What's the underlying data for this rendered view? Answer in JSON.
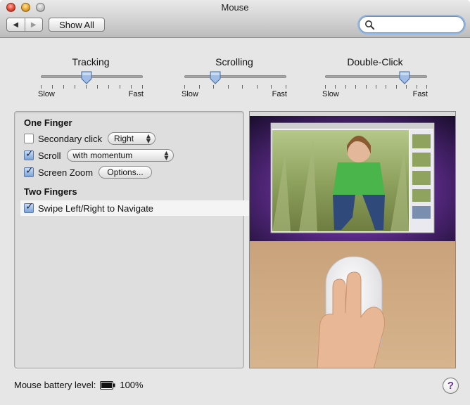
{
  "window": {
    "title": "Mouse"
  },
  "toolbar": {
    "back_icon": "back-arrow",
    "forward_icon": "forward-arrow",
    "show_all_label": "Show All",
    "search_value": "",
    "search_placeholder": ""
  },
  "sliders": [
    {
      "label": "Tracking",
      "min_label": "Slow",
      "max_label": "Fast",
      "ticks": 10,
      "value_fraction": 0.45
    },
    {
      "label": "Scrolling",
      "min_label": "Slow",
      "max_label": "Fast",
      "ticks": 8,
      "value_fraction": 0.3
    },
    {
      "label": "Double-Click",
      "min_label": "Slow",
      "max_label": "Fast",
      "ticks": 11,
      "value_fraction": 0.78
    }
  ],
  "options": {
    "one_finger_heading": "One Finger",
    "secondary_click": {
      "label": "Secondary click",
      "checked": false,
      "popup": "Right"
    },
    "scroll": {
      "label": "Scroll",
      "checked": true,
      "popup": "with momentum"
    },
    "screen_zoom": {
      "label": "Screen Zoom",
      "checked": true,
      "button": "Options..."
    },
    "two_fingers_heading": "Two Fingers",
    "swipe": {
      "label": "Swipe Left/Right to Navigate",
      "checked": true
    }
  },
  "preview": {
    "description_icon": "gesture-preview-video"
  },
  "footer": {
    "battery_label": "Mouse battery level:",
    "battery_value": "100%",
    "help_label": "?"
  },
  "colors": {
    "accent": "#5a79a8",
    "help": "#6a2ea0"
  }
}
